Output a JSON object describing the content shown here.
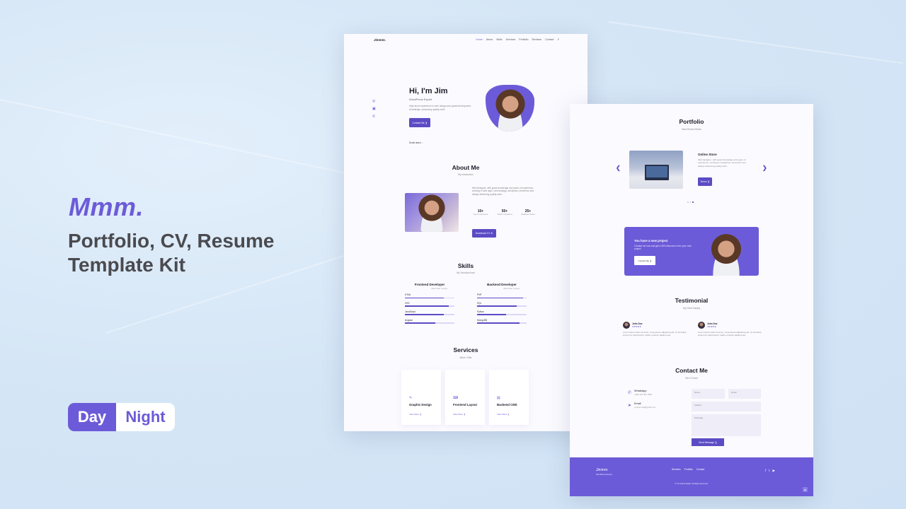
{
  "promo": {
    "brand": "Mmm.",
    "title": "Portfolio, CV, Resume Template Kit",
    "mode_toggle": {
      "day": "Day",
      "night": "Night"
    },
    "accent": "#6c5bd8"
  },
  "page1": {
    "nav": {
      "logo": "Jimmm.",
      "links": [
        "Home",
        "About",
        "Skills",
        "Services",
        "Portfolio",
        "Reviews",
        "Contact"
      ],
      "active": "Home",
      "search_icon": "⌕"
    },
    "social_icons": [
      "dribbble-icon",
      "linkedin-icon",
      "whatsapp-icon"
    ],
    "hero": {
      "title": "Hi, I'm Jim",
      "subtitle": "WordPress Expert",
      "description": "High level experience in web design and great development knowledge, producing quality work",
      "button": "Contact Me ❯",
      "scroll_down": "Scroll down ↓"
    },
    "about": {
      "title": "About Me",
      "subtitle": "My introduction",
      "description": "Web designer, with great knowledge and years of experience, working in web apps, web analogy, wordpress, elementor and always delivering quality work.",
      "stats": [
        {
          "value": "10+",
          "label": "Years experience"
        },
        {
          "value": "50+",
          "label": "Tasks completed"
        },
        {
          "value": "25+",
          "label": "Satisfied clients"
        }
      ],
      "button": "Download CV ⬇"
    },
    "skills": {
      "title": "Skills",
      "subtitle": "My Technical level",
      "groups": [
        {
          "title": "Frontend Developer",
          "subtitle": "More than 4 years",
          "items": [
            {
              "name": "HTML",
              "level": 0.78
            },
            {
              "name": "CSS",
              "level": 0.89
            },
            {
              "name": "JavaScript",
              "level": 0.78
            },
            {
              "name": "Angular",
              "level": 0.61
            }
          ]
        },
        {
          "title": "Backend Developer",
          "subtitle": "More than 5 years",
          "items": [
            {
              "name": "PHP",
              "level": 0.93
            },
            {
              "name": "SQL",
              "level": 0.8
            },
            {
              "name": "Python",
              "level": 0.58
            },
            {
              "name": "MongoDB",
              "level": 0.85
            }
          ]
        }
      ]
    },
    "services": {
      "title": "Services",
      "subtitle": "What I Offer",
      "items": [
        {
          "icon": "graphic-design-icon",
          "glyph": "✎",
          "title": "Graphic Design",
          "link": "View More ❯"
        },
        {
          "icon": "frontend-icon",
          "glyph": "⌨",
          "title": "Frontend Layout",
          "link": "View More ❯"
        },
        {
          "icon": "cms-icon",
          "glyph": "▤",
          "title": "Backend CMS",
          "link": "View More ❯"
        }
      ]
    }
  },
  "page2": {
    "portfolio": {
      "title": "Portfolio",
      "subtitle": "Most Recent Works",
      "item_title": "Online Store",
      "item_desc": "Web designer, with great knowledge and years of experience, working in wordpress, elementor and always delivering quality work.",
      "button": "Demo ❯",
      "prev": "❮",
      "next": "❯",
      "active_dot": 2
    },
    "project_banner": {
      "title": "You have a new project",
      "description": "Contact me now and get a 30% discount on the your new project",
      "button": "Contact Me ❯"
    },
    "testimonial": {
      "title": "Testimonial",
      "subtitle": "My Client Saying",
      "items": [
        {
          "name": "John Doe",
          "stars": "★★★★★",
          "text": "Lorem ipsum dolor sit amet, consectetur adipiscing elit. Ut elit tellus, luctus nec ullamcorper mattis, pulvinar dapibus leo."
        },
        {
          "name": "John Doe",
          "stars": "★★★★★",
          "text": "Lorem ipsum dolor sit amet, consectetur adipiscing elit. Ut elit tellus, luctus nec ullamcorper mattis, pulvinar dapibus leo."
        }
      ]
    },
    "contact": {
      "title": "Contact Me",
      "subtitle": "Get in Touch",
      "info": [
        {
          "icon": "whatsapp-icon",
          "glyph": "✆",
          "label": "WhatsApp",
          "value": "+999 123 456 7890"
        },
        {
          "icon": "send-icon",
          "glyph": "➤",
          "label": "Email",
          "value": "youjoinmail@gmail.com"
        }
      ],
      "form": {
        "name_placeholder": "Name",
        "email_placeholder": "Email",
        "subject_placeholder": "Subject",
        "message_placeholder": "Message",
        "send": "Send Message ❯"
      }
    },
    "footer": {
      "logo": "Jimmm.",
      "tagline": "WordPress Expert",
      "links": [
        "Services",
        "Portfolio",
        "Contact"
      ],
      "copyright": "© Jim Fahad Digital. All Rights Reserved.",
      "social": [
        "facebook-icon",
        "twitter-icon",
        "youtube-icon"
      ],
      "social_glyphs": [
        "f",
        "t",
        "▶"
      ],
      "to_top": "▲"
    }
  }
}
